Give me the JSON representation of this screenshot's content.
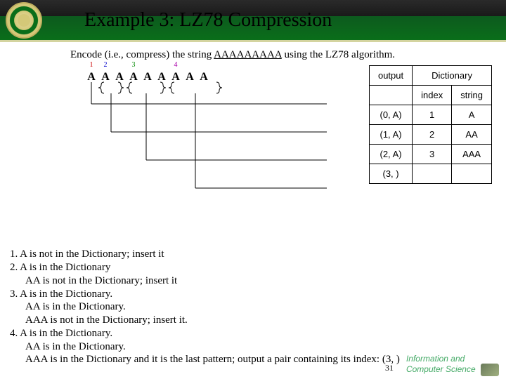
{
  "header": {
    "title": "Example 3: LZ78 Compression"
  },
  "instruction": {
    "prefix": "Encode (i.e., compress) the string ",
    "target": "AAAAAAAAA",
    "suffix": " using the LZ78 algorithm."
  },
  "string": {
    "chars": [
      "A",
      "A",
      "A",
      "A",
      "A",
      "A",
      "A",
      "A",
      "A"
    ],
    "nums": [
      "1",
      "2",
      "",
      "3",
      "",
      "",
      "4",
      "",
      ""
    ]
  },
  "table": {
    "dict_header": "Dictionary",
    "cols": [
      "output",
      "index",
      "string"
    ],
    "rows": [
      {
        "output": "(0, A)",
        "index": "1",
        "string": "A"
      },
      {
        "output": "(1, A)",
        "index": "2",
        "string": "AA"
      },
      {
        "output": "(2, A)",
        "index": "3",
        "string": "AAA"
      },
      {
        "output": "(3,  )",
        "index": "",
        "string": ""
      }
    ]
  },
  "steps": [
    {
      "n": "1.",
      "lines": [
        "A is not in the Dictionary; insert it"
      ]
    },
    {
      "n": "2.",
      "lines": [
        "A is in the Dictionary",
        "AA is not in the Dictionary; insert it"
      ]
    },
    {
      "n": "3.",
      "lines": [
        "A is in the Dictionary.",
        "AA is in the Dictionary.",
        "AAA is not in the Dictionary; insert it."
      ]
    },
    {
      "n": "4.",
      "lines": [
        "A is in the Dictionary.",
        "AA is in the Dictionary.",
        "AAA is in the Dictionary and it is the last pattern; output a pair containing its index: (3,  )"
      ]
    }
  ],
  "page": "31",
  "footer": {
    "t1": "Information and",
    "t2": "Computer Science"
  }
}
